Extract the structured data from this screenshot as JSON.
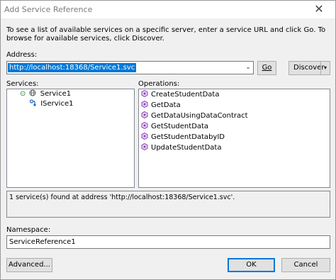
{
  "window": {
    "title": "Add Service Reference",
    "close_glyph": "✕"
  },
  "intro_text": "To see a list of available services on a specific server, enter a service URL and click Go. To browse for available services, click Discover.",
  "address": {
    "label": "Address:",
    "value": "http://localhost:18368/Service1.svc",
    "dropdown_glyph": "⌄"
  },
  "buttons": {
    "go": "Go",
    "discover": "Discover",
    "discover_arrow": "▾",
    "advanced": "Advanced...",
    "ok": "OK",
    "cancel": "Cancel"
  },
  "services": {
    "label": "Services:",
    "items": [
      {
        "label": "Service1",
        "icon": "globe-service-icon",
        "expander": "⊙"
      },
      {
        "label": "IService1",
        "icon": "interface-icon"
      }
    ]
  },
  "operations": {
    "label": "Operations:",
    "icon": "operation-icon",
    "icon_color": "#8b3fb5",
    "items": [
      "CreateStudentData",
      "GetData",
      "GetDataUsingDataContract",
      "GetStudentData",
      "GetStudentDatabyID",
      "UpdateStudentData"
    ]
  },
  "status_text": "1 service(s) found at address 'http://localhost:18368/Service1.svc'.",
  "namespace": {
    "label": "Namespace:",
    "value": "ServiceReference1"
  },
  "colors": {
    "selection": "#0078d7",
    "dialog_bg": "#f0f0f0"
  }
}
